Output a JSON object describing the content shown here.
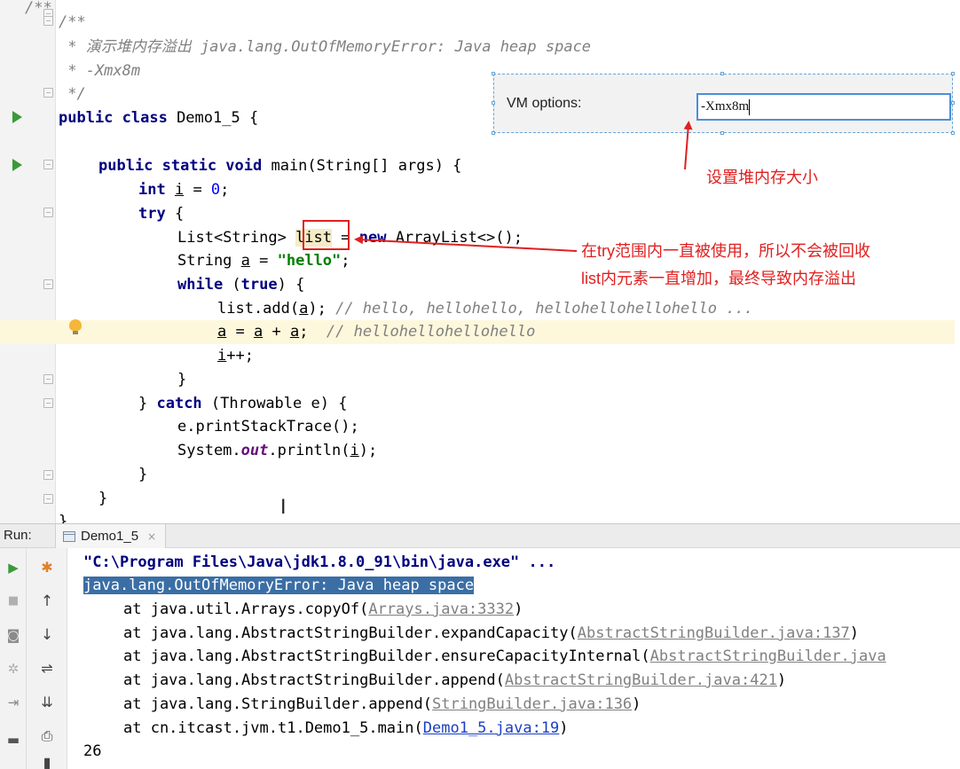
{
  "editor": {
    "lines": [
      {
        "text": "/**"
      },
      {
        "text": "/**"
      },
      {
        "text": " * 演示堆内存溢出 java.lang.OutOfMemoryError: Java heap space"
      },
      {
        "text": " * -Xmx8m"
      },
      {
        "text": " */"
      },
      {
        "kw": "public class ",
        "rest": "Demo1_5 {"
      },
      {
        "kw1": "public static void ",
        "rest": "main(String[] args) {"
      },
      {
        "kw": "int ",
        "var": "i",
        "mid": " = ",
        "num": "0",
        "end": ";"
      },
      {
        "kw": "try ",
        "rest": "{"
      },
      {
        "pre": "List<String> ",
        "var": "list",
        "mid": " = ",
        "kw": "new ",
        "rest": "ArrayList<>();"
      },
      {
        "pre": "String ",
        "var": "a",
        "mid": " = ",
        "str": "\"hello\"",
        "end": ";"
      },
      {
        "kw": "while ",
        "p1": "(",
        "kw2": "true",
        "p2": ") {"
      },
      {
        "pre": "list.add(",
        "var": "a",
        "mid": "); ",
        "cm": "// hello, hellohello, hellohellohellohello ..."
      },
      {
        "v1": "a",
        "m1": " = ",
        "v2": "a",
        "m2": " + ",
        "v3": "a",
        "m3": ";  ",
        "cm": "// hellohellohellohello"
      },
      {
        "var": "i",
        "rest": "++;"
      },
      {
        "text": "}"
      },
      {
        "p1": "} ",
        "kw": "catch ",
        "rest": "(Throwable e) {"
      },
      {
        "text": "e.printStackTrace();"
      },
      {
        "pre": "System.",
        "field": "out",
        "mid": ".println(",
        "var": "i",
        "end": ");"
      },
      {
        "text": "}"
      },
      {
        "text": "}"
      },
      {
        "text": "}"
      }
    ]
  },
  "vm_options": {
    "label": "VM options:",
    "value": "-Xmx8m"
  },
  "annotations": {
    "heap_note": "设置堆内存大小",
    "list_note_1": "在try范围内一直被使用，所以不会被回收",
    "list_note_2": "list内元素一直增加，最终导致内存溢出"
  },
  "run_panel": {
    "label": "Run:",
    "tab": "Demo1_5",
    "tab_close": "×",
    "output": {
      "cmd": "\"C:\\Program Files\\Java\\jdk1.8.0_91\\bin\\java.exe\" ...",
      "error": "java.lang.OutOfMemoryError: Java heap space",
      "trace": [
        {
          "prefix": "at java.util.Arrays.copyOf(",
          "link": "Arrays.java:3332",
          "suffix": ")"
        },
        {
          "prefix": "at java.lang.AbstractStringBuilder.expandCapacity(",
          "link": "AbstractStringBuilder.java:137",
          "suffix": ")"
        },
        {
          "prefix": "at java.lang.AbstractStringBuilder.ensureCapacityInternal(",
          "link": "AbstractStringBuilder.java",
          "suffix": ""
        },
        {
          "prefix": "at java.lang.AbstractStringBuilder.append(",
          "link": "AbstractStringBuilder.java:421",
          "suffix": ")"
        },
        {
          "prefix": "at java.lang.StringBuilder.append(",
          "link": "StringBuilder.java:136",
          "suffix": ")"
        },
        {
          "prefix": "at cn.itcast.jvm.t1.Demo1_5.main(",
          "link": "Demo1_5.java:19",
          "suffix": ")"
        }
      ],
      "result": "26"
    }
  },
  "colors": {
    "keyword": "#000080",
    "string": "#008000",
    "comment": "#808080",
    "annotation_red": "#e02020",
    "selection": "#3a6ea5"
  }
}
